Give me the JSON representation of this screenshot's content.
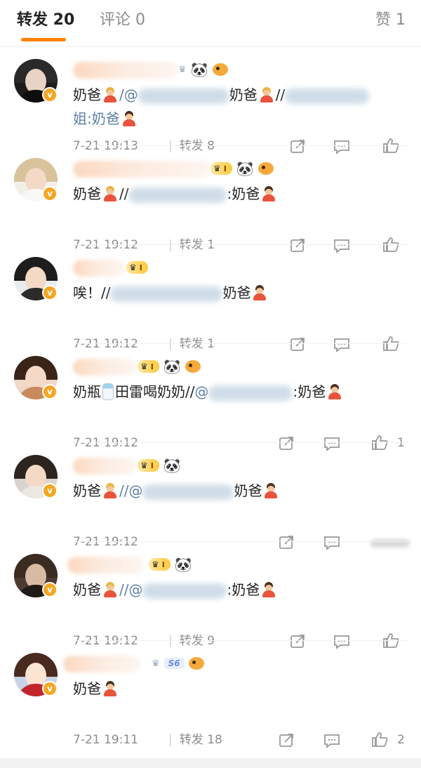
{
  "tabs": {
    "repost": "转发 20",
    "comment": "评论 0",
    "like": "赞 1"
  },
  "icons": {
    "verified": "verified-badge-icon",
    "share": "share-icon",
    "comment": "comment-icon",
    "like": "thumbs-up-icon"
  },
  "items": [
    {
      "c1": "奶爸",
      "c2": "/@",
      "c3": "奶爸",
      "c4": "//",
      "c5": "姐:奶爸",
      "time": "7-21 19:13",
      "repost": "转发 8"
    },
    {
      "c1": "奶爸",
      "c2": "//",
      "c3": ":奶爸",
      "time": "7-21 19:12",
      "repost": "转发 1"
    },
    {
      "c1": "唉！//",
      "c3": "奶爸",
      "time": "7-21 19:12",
      "repost": "转发 1"
    },
    {
      "c1": "奶瓶",
      "c2": "田雷喝奶奶//",
      "c3": "@",
      "c4": ":奶爸",
      "time": "7-21 19:12",
      "likes": "1"
    },
    {
      "c1": "奶爸",
      "c2": "//@",
      "c3": "奶爸",
      "time": "7-21 19:12"
    },
    {
      "c1": "奶爸",
      "c2": "//@",
      "c3": ":奶爸",
      "time": "7-21 19:12",
      "repost": "转发 9"
    },
    {
      "c1": "奶爸",
      "time": "7-21 19:11",
      "repost": "转发 18",
      "likes": "2"
    }
  ],
  "badge_texts": {
    "level": "I",
    "s6": "S6",
    "verified": "v"
  }
}
